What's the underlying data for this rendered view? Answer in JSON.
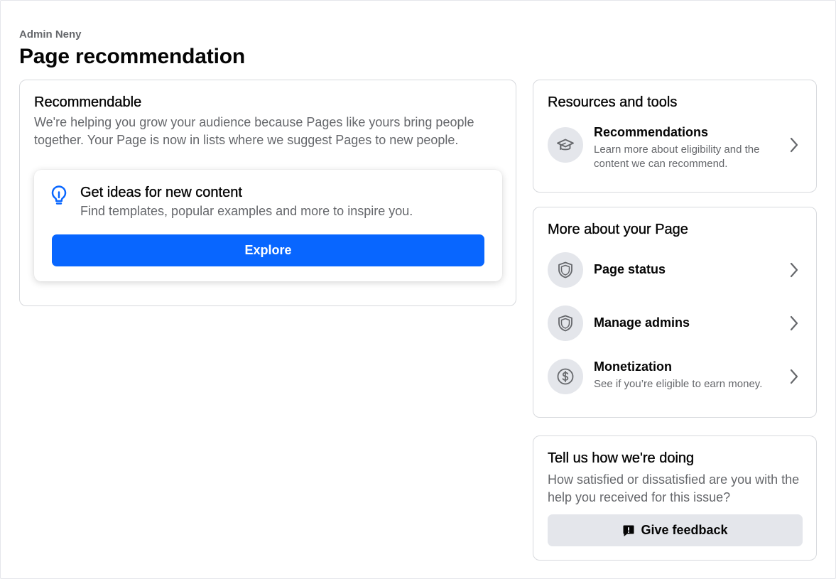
{
  "header": {
    "page_owner": "Admin Neny",
    "title": "Page recommendation"
  },
  "recommendable": {
    "title": "Recommendable",
    "description": "We're helping you grow your audience because Pages like yours bring people together. Your Page is now in lists where we suggest Pages to new people.",
    "ideas_card": {
      "icon": "lightbulb-icon",
      "title": "Get ideas for new content",
      "subtitle": "Find templates, popular examples and more to inspire you.",
      "button_label": "Explore"
    }
  },
  "resources": {
    "title": "Resources and tools",
    "items": [
      {
        "icon": "graduation-cap-icon",
        "title": "Recommendations",
        "subtitle": "Learn more about eligibility and the content we can recommend."
      }
    ]
  },
  "more_about": {
    "title": "More about your Page",
    "items": [
      {
        "icon": "shield-icon",
        "title": "Page status",
        "subtitle": ""
      },
      {
        "icon": "shield-icon",
        "title": "Manage admins",
        "subtitle": ""
      },
      {
        "icon": "dollar-circle-icon",
        "title": "Monetization",
        "subtitle": "See if you’re eligible to earn money."
      }
    ]
  },
  "feedback": {
    "title": "Tell us how we're doing",
    "description": "How satisfied or dissatisfied are you with the help you received for this issue?",
    "button_label": "Give feedback",
    "button_icon": "feedback-icon"
  },
  "colors": {
    "primary_button": "#0866ff",
    "secondary_button": "#e4e6eb",
    "muted_text": "#65676b",
    "icon_circle": "#e4e6eb"
  }
}
